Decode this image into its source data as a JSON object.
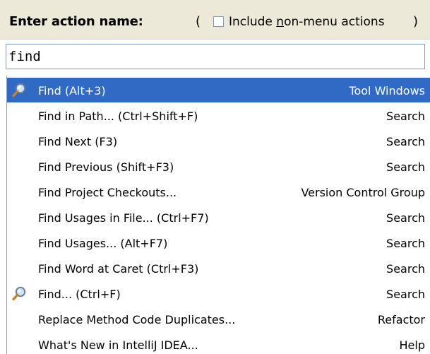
{
  "header": {
    "prompt": "Enter action name:",
    "paren_open": "(",
    "paren_close": ")",
    "checkbox_checked": false,
    "checkbox_label_before": "Include ",
    "checkbox_label_mnemonic": "n",
    "checkbox_label_after": "on-menu actions"
  },
  "search": {
    "value": "find"
  },
  "colors": {
    "selection": "#316ac5",
    "header_bg": "#ece9d8",
    "border": "#7f9db9"
  },
  "results": [
    {
      "name": "Find (Alt+3)",
      "group": "Tool Windows",
      "icon": "magnifier-icon",
      "selected": true
    },
    {
      "name": "Find in Path... (Ctrl+Shift+F)",
      "group": "Search"
    },
    {
      "name": "Find Next (F3)",
      "group": "Search"
    },
    {
      "name": "Find Previous (Shift+F3)",
      "group": "Search"
    },
    {
      "name": "Find Project Checkouts...",
      "group": "Version Control Group"
    },
    {
      "name": "Find Usages in File... (Ctrl+F7)",
      "group": "Search"
    },
    {
      "name": "Find Usages... (Alt+F7)",
      "group": "Search"
    },
    {
      "name": "Find Word at Caret (Ctrl+F3)",
      "group": "Search"
    },
    {
      "name": "Find... (Ctrl+F)",
      "group": "Search",
      "icon": "magnifier-icon"
    },
    {
      "name": "Replace Method Code Duplicates...",
      "group": "Refactor"
    },
    {
      "name": "What's New in IntelliJ IDEA...",
      "group": "Help"
    }
  ]
}
